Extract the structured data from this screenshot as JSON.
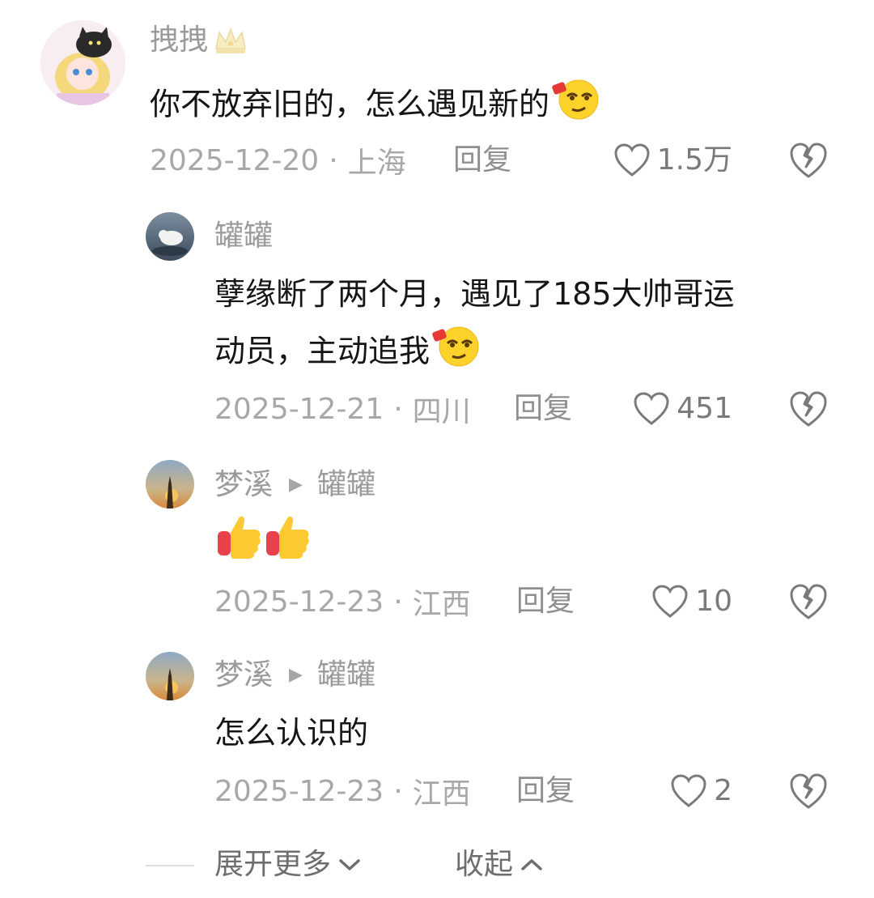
{
  "comments": [
    {
      "user": "拽拽",
      "text": "你不放弃旧的，怎么遇见新的",
      "date": "2025-12-20",
      "location": "上海",
      "reply_label": "回复",
      "likes": "1.5万"
    },
    {
      "user": "罐罐",
      "text_line1": "孽缘断了两个月，遇见了185大帅哥运",
      "text_line2": "动员，主动追我",
      "date": "2025-12-21",
      "location": "四川",
      "reply_label": "回复",
      "likes": "451"
    },
    {
      "user": "梦溪",
      "reply_to": "罐罐",
      "text": "",
      "date": "2025-12-23",
      "location": "江西",
      "reply_label": "回复",
      "likes": "10"
    },
    {
      "user": "梦溪",
      "reply_to": "罐罐",
      "text": "怎么认识的",
      "date": "2025-12-23",
      "location": "江西",
      "reply_label": "回复",
      "likes": "2"
    }
  ],
  "footer": {
    "expand_label": "展开更多",
    "collapse_label": "收起"
  },
  "separator": "·",
  "icons": {
    "like": "heart-outline-icon",
    "dislike": "broken-heart-icon",
    "emoji": "smirk-emoji-icon",
    "thumbs": "thumbs-up-emoji-icon",
    "reply_arrow": "triangle-right-icon",
    "crown": "crown-icon"
  }
}
